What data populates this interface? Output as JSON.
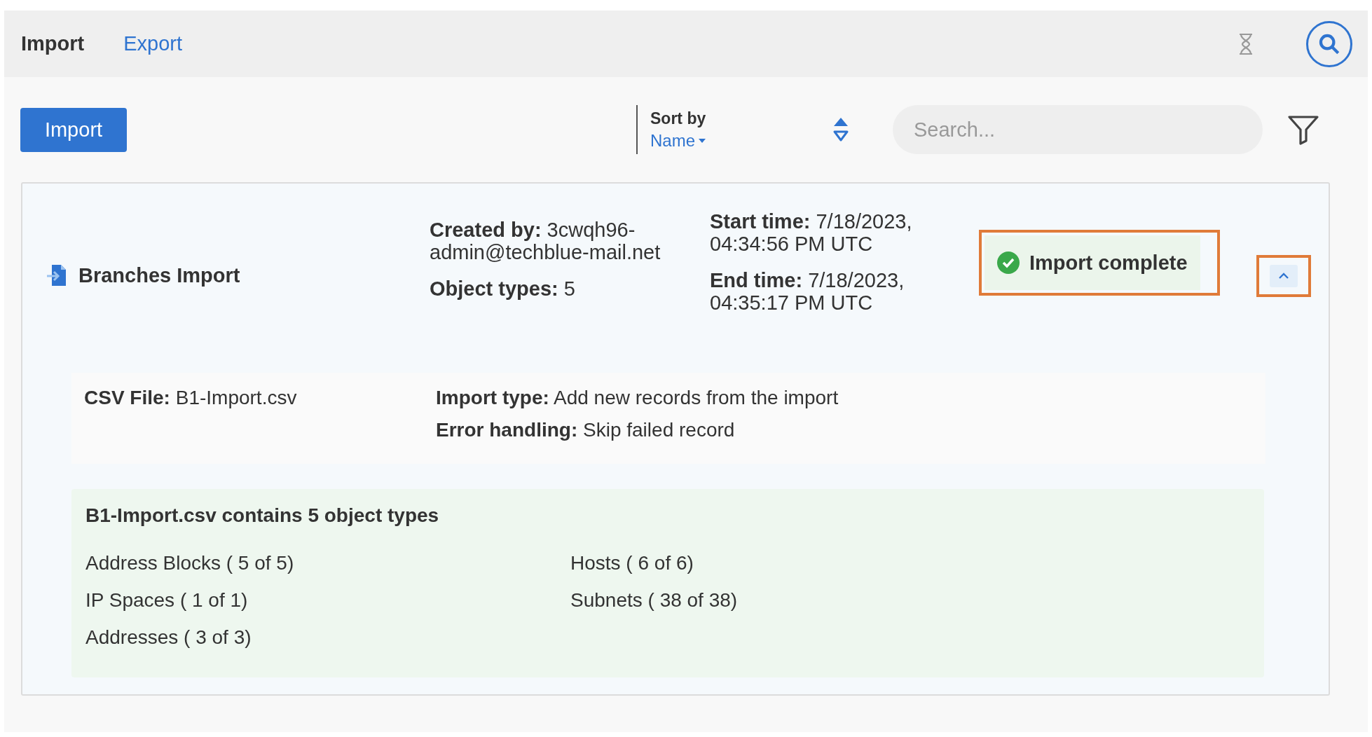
{
  "tabs": [
    {
      "label": "Import",
      "selected": true
    },
    {
      "label": "Export",
      "selected": false
    }
  ],
  "toolbar": {
    "import_button": "Import",
    "sort": {
      "label": "Sort by",
      "value": "Name"
    },
    "search": {
      "placeholder": "Search..."
    }
  },
  "import_job": {
    "title": "Branches Import",
    "created_by": "**Created by:**  3cwqh96-admin@techblue-mail.net",
    "object_types": "**Object types:**  5",
    "start_time": "**Start time:** 7/18/2023, 04:34:56 PM UTC",
    "end_time": "**End time:**  7/18/2023, 04:35:17 PM UTC",
    "status": {
      "label": "Import complete",
      "kind": "success",
      "highlighted": true
    },
    "expanded": true,
    "toggle_highlighted": true,
    "details": {
      "csv_file": "**CSV File:** B1-Import.csv",
      "import_type": "**Import type:** Add new records from the import",
      "error_handling": "**Error handling:** Skip failed record"
    },
    "summary": {
      "title": "B1-Import.csv contains 5 object types",
      "object_types": [
        "Address Blocks ( 5 of 5)",
        "IP Spaces ( 1 of 1)",
        "Addresses ( 3 of 3)",
        "Hosts ( 6 of 6)",
        "Subnets ( 38 of 38)"
      ]
    }
  }
}
